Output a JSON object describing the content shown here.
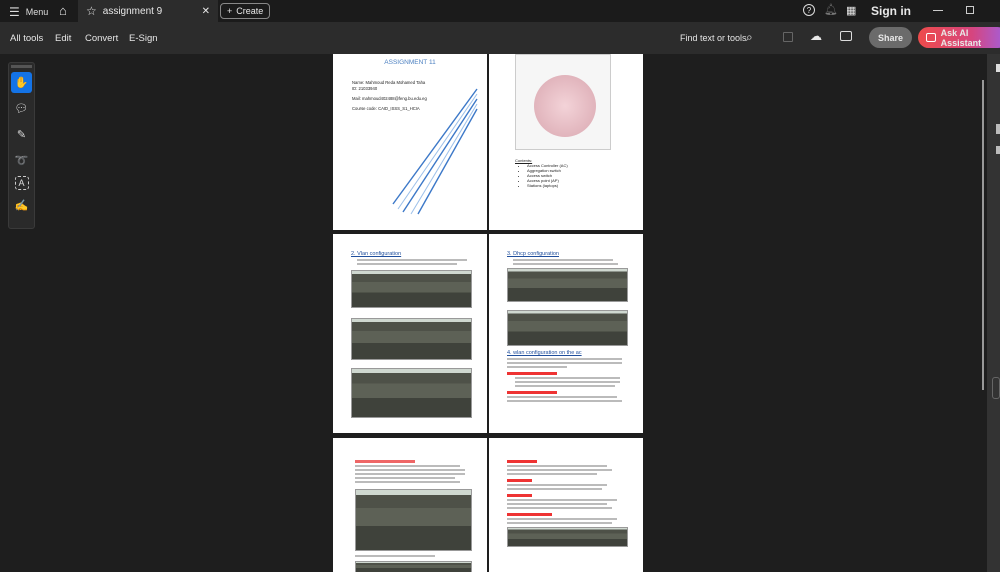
{
  "titlebar": {
    "menu": "Menu",
    "tab_title": "assignment 9",
    "create": "Create",
    "sign_in": "Sign in"
  },
  "toolbar": {
    "all_tools": "All tools",
    "edit": "Edit",
    "convert": "Convert",
    "esign": "E-Sign",
    "find": "Find text or tools",
    "share": "Share",
    "ai": "Ask AI Assistant"
  },
  "pages": {
    "p1": {
      "title": "ASSIGNMENT 11",
      "name": "Name: Mahmoud Reda Mohamed Taha",
      "id": "ID: 21033940",
      "mail": "Mail: mahmoud402488@feng.bu.edu.eg",
      "course": "Course code: CAID_ISSS_S1_HCIA"
    },
    "p2": {
      "contents": "Contents:",
      "items": [
        "Access Controller (AC)",
        "Aggregation switch",
        "Access switch",
        "Access point (AP)",
        "Stations (laptops)"
      ]
    },
    "p3": {
      "heading": "2. Vlan configuration"
    },
    "p4": {
      "heading": "3. Dhcp configuration",
      "heading2": "4. wlan configuration on the ac"
    }
  }
}
